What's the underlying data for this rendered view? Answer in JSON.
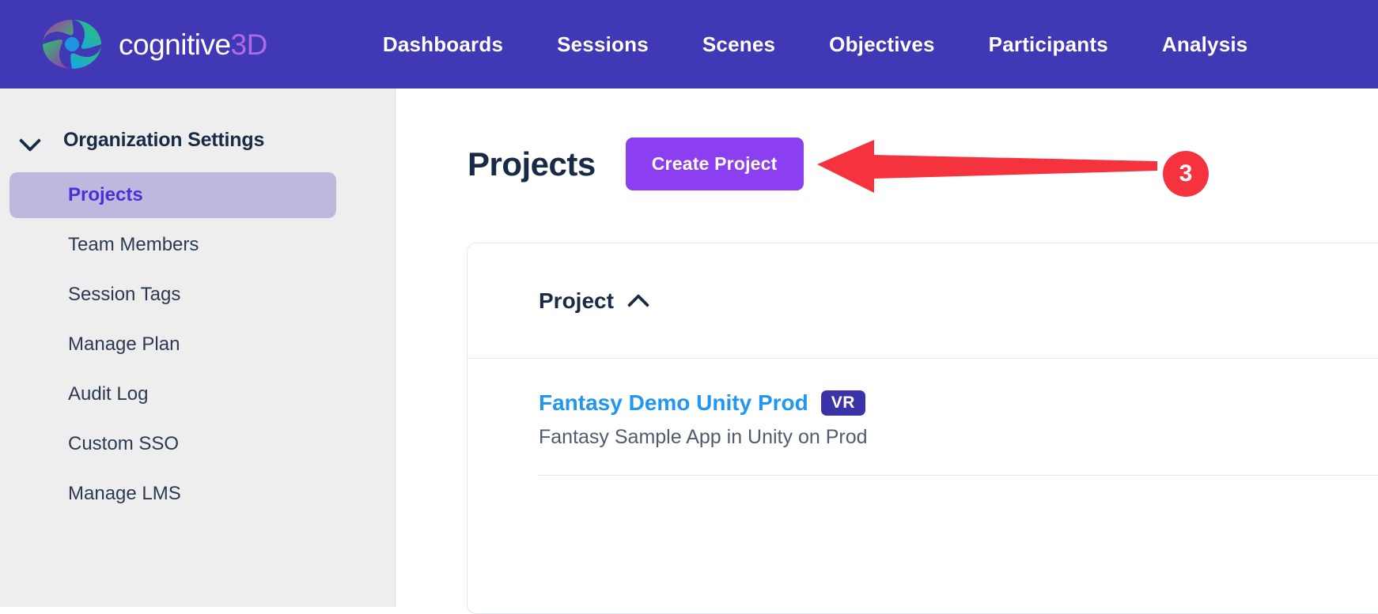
{
  "brand": {
    "name_white": "cognitive",
    "name_accent": "3D",
    "logo_icon": "cognitive3d-swirl-logo"
  },
  "topnav": {
    "background": "#4038b4",
    "items": [
      {
        "label": "Dashboards"
      },
      {
        "label": "Sessions"
      },
      {
        "label": "Scenes"
      },
      {
        "label": "Objectives"
      },
      {
        "label": "Participants"
      },
      {
        "label": "Analysis"
      }
    ]
  },
  "sidebar": {
    "background": "#eeeeee",
    "section_title": "Organization Settings",
    "collapse_icon": "chevron-down-icon",
    "items": [
      {
        "label": "Projects",
        "active": true
      },
      {
        "label": "Team Members",
        "active": false
      },
      {
        "label": "Session Tags",
        "active": false
      },
      {
        "label": "Manage Plan",
        "active": false
      },
      {
        "label": "Audit Log",
        "active": false
      },
      {
        "label": "Custom SSO",
        "active": false
      },
      {
        "label": "Manage LMS",
        "active": false
      }
    ],
    "active_bg": "#bdb8dd",
    "active_color": "#4a2fd4"
  },
  "main": {
    "page_title": "Projects",
    "create_button": {
      "label": "Create Project",
      "color": "#8b3ff0"
    },
    "table": {
      "columns": [
        {
          "label": "Project",
          "sort_icon": "chevron-up-icon",
          "sort": "ascending"
        }
      ],
      "rows": [
        {
          "name": "Fantasy Demo Unity Prod",
          "badge": "VR",
          "badge_color": "#3c33a8",
          "description": "Fantasy Sample App in Unity on Prod",
          "name_color": "#2196f3"
        }
      ]
    }
  },
  "annotation": {
    "arrow_icon": "left-arrow-annotation",
    "arrow_color": "#f5333f",
    "step_badge": "3",
    "step_badge_color": "#f5333f"
  }
}
